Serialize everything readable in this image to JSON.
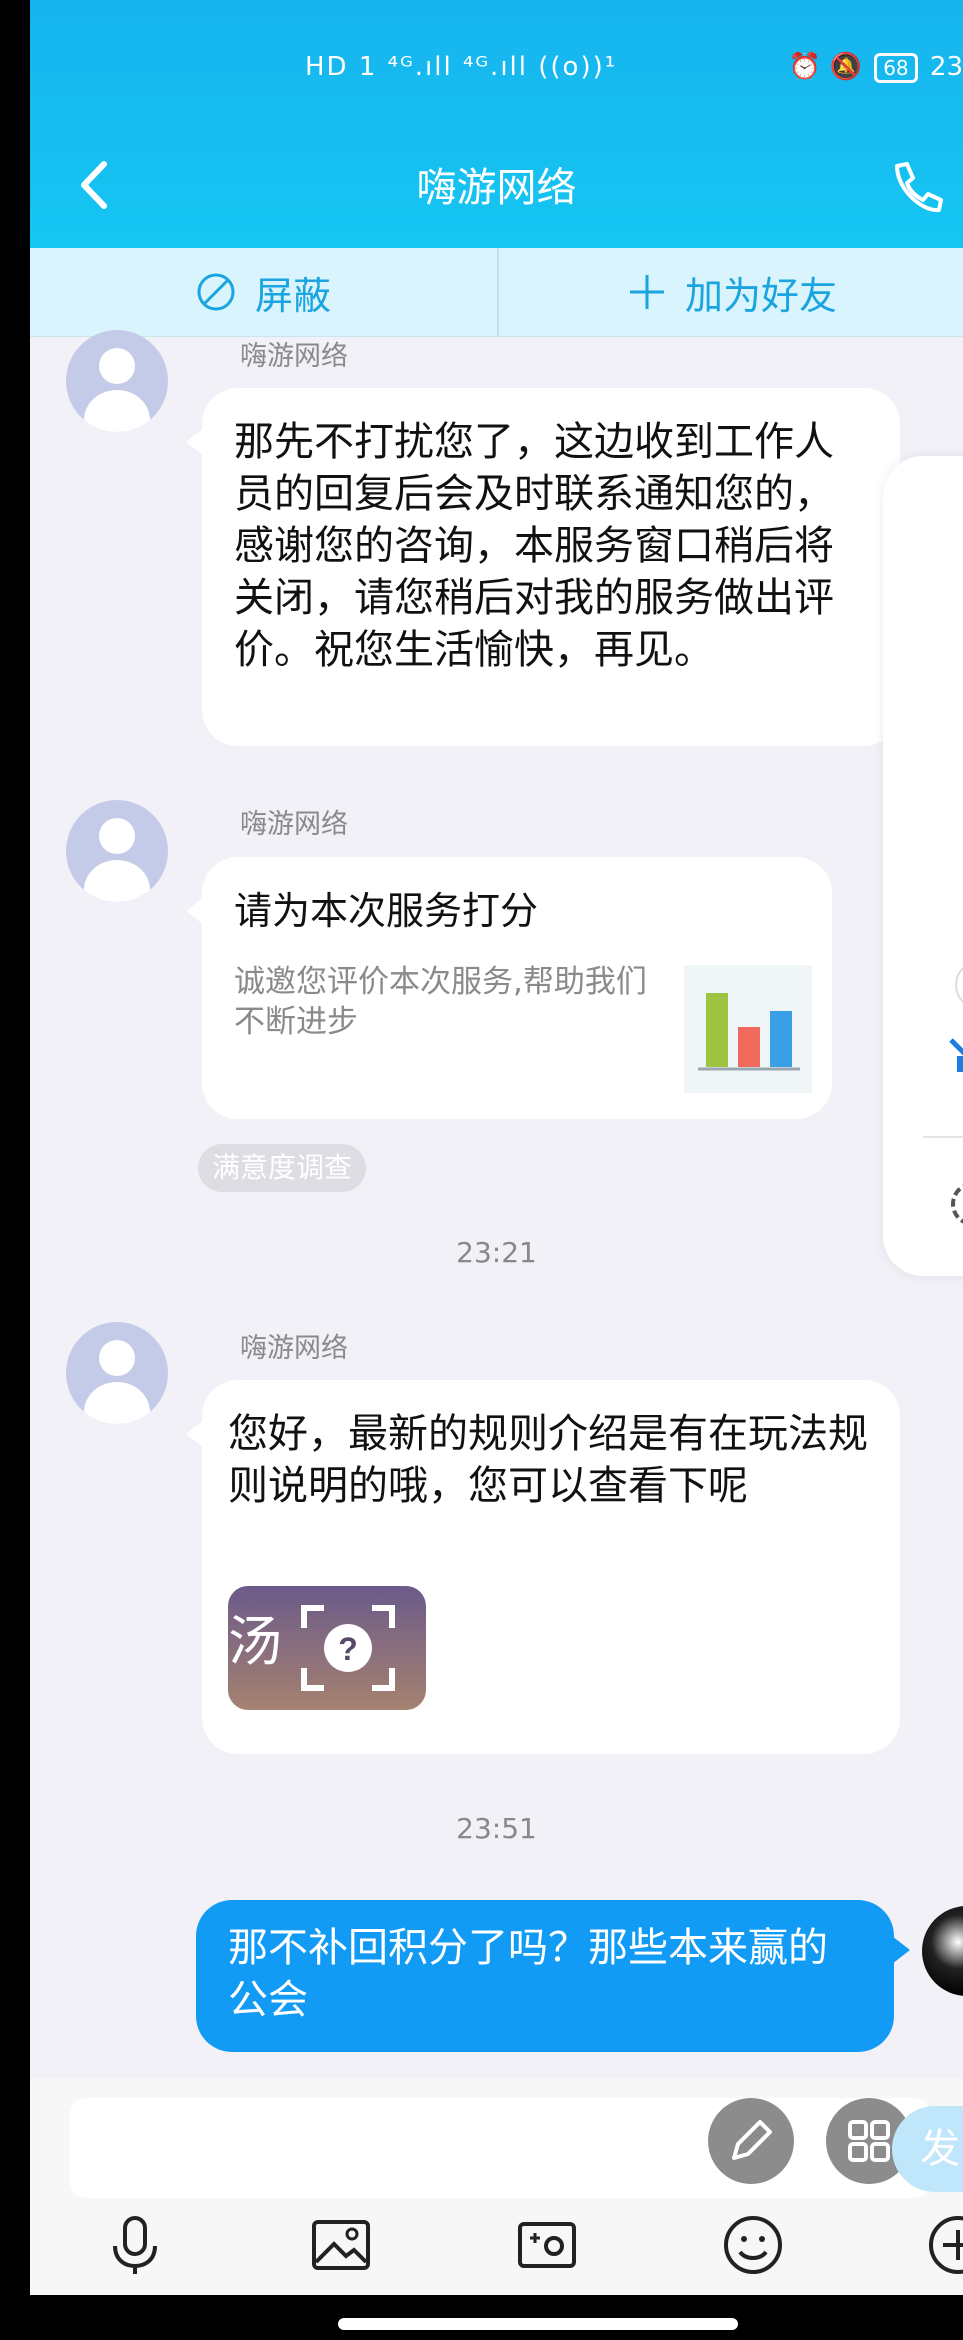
{
  "status_bar": {
    "left_icons": "HD 1 ⁴ᴳ.ıll ⁴ᴳ.ıll ((o))¹",
    "battery": "68",
    "clock_partial": "23"
  },
  "header": {
    "title": "嗨游网络"
  },
  "actions": {
    "block": "屏蔽",
    "add_friend": "加为好友"
  },
  "messages": {
    "m1_sender": "嗨游网络",
    "m1_text": "那先不打扰您了，这边收到工作人员的回复后会及时联系通知您的，感谢您的咨询，本服务窗口稍后将关闭，请您稍后对我的服务做出评价。祝您生活愉快，再见。",
    "m2_sender": "嗨游网络",
    "m2_card_title": "请为本次服务打分",
    "m2_card_desc": "诚邀您评价本次服务,帮助我们不断进步",
    "m2_tag": "满意度调查",
    "time1": "23:21",
    "m3_sender": "嗨游网络",
    "m3_text": "您好，最新的规则介绍是有在玩法规则说明的哦，您可以查看下呢",
    "m3_image_text": "汤",
    "time2": "23:51",
    "m4_text": "那不补回积分了吗？那些本来赢的公会"
  },
  "input": {
    "send_partial": "发"
  },
  "colors": {
    "header_blue": "#16b4ee",
    "outgoing_bubble": "#129bf4",
    "action_bar": "#d9f4fc"
  },
  "icons": [
    "back-icon",
    "phone-icon",
    "block-icon",
    "plus-icon",
    "voice-icon",
    "image-icon",
    "camera-icon",
    "emoji-icon",
    "add-icon",
    "edit-icon",
    "grid-icon",
    "mute-icon",
    "settings-icon"
  ]
}
